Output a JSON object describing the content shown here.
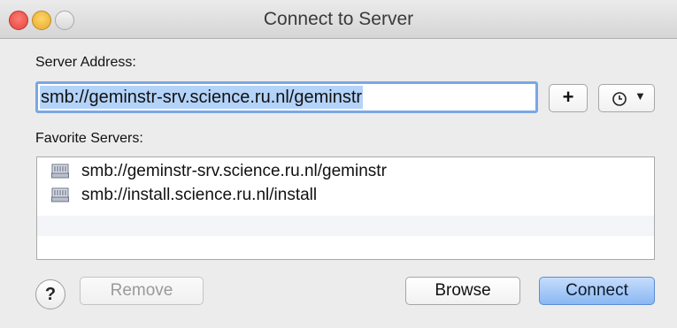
{
  "window": {
    "title": "Connect to Server"
  },
  "server_address": {
    "label": "Server Address:",
    "value": "smb://geminstr-srv.science.ru.nl/geminstr"
  },
  "toolbar": {
    "add_label": "+",
    "recent_icon": "clock-icon",
    "recent_dropdown": "▼"
  },
  "favorites": {
    "label": "Favorite Servers:",
    "items": [
      {
        "icon": "network-server-icon",
        "label": "smb://geminstr-srv.science.ru.nl/geminstr"
      },
      {
        "icon": "network-server-icon",
        "label": "smb://install.science.ru.nl/install"
      }
    ]
  },
  "footer": {
    "help_label": "?",
    "remove_label": "Remove",
    "browse_label": "Browse",
    "connect_label": "Connect"
  },
  "colors": {
    "focus_ring": "#7aa7e4",
    "selection": "#b4d3f9",
    "default_button": "#8ab8f3"
  }
}
